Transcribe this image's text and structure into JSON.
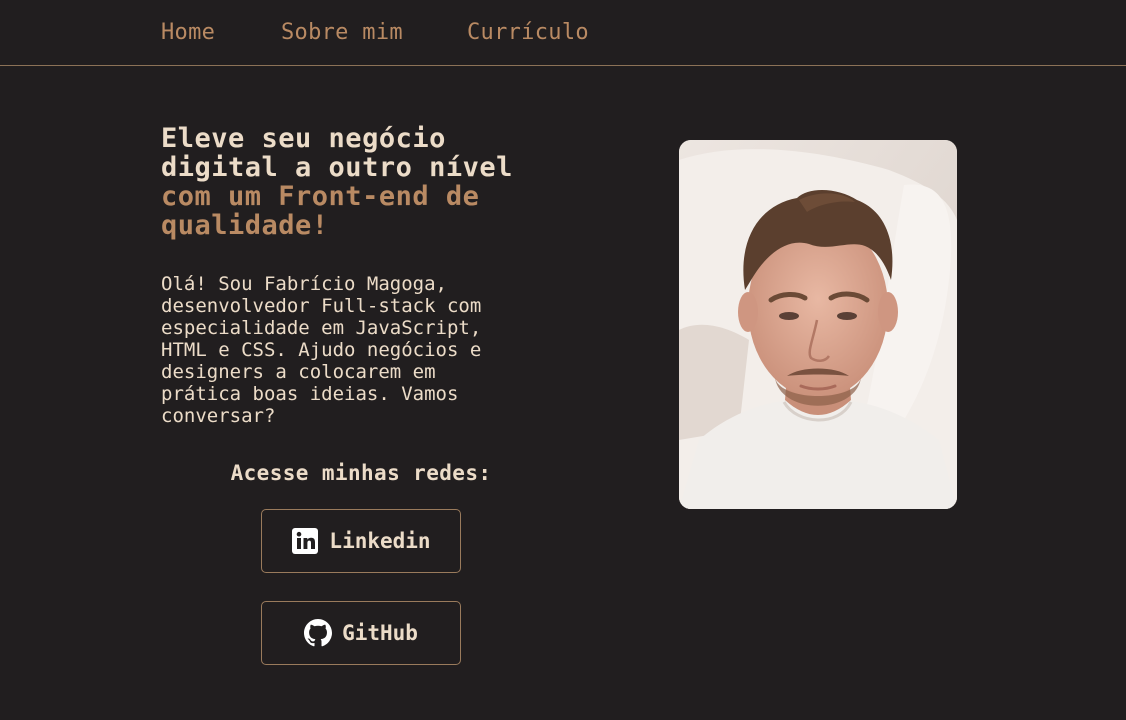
{
  "nav": {
    "items": [
      {
        "label": "Home"
      },
      {
        "label": "Sobre mim"
      },
      {
        "label": "Currículo"
      }
    ]
  },
  "hero": {
    "headline_line1": "Eleve seu negócio",
    "headline_line2": "digital a outro nível",
    "headline_accent1": "com um Front-end de",
    "headline_accent2": "qualidade!",
    "intro_lines": [
      "Olá! Sou Fabrício Magoga,",
      "desenvolvedor Full-stack com",
      "especialidade em JavaScript,",
      "HTML e CSS. Ajudo negócios e",
      "designers a colocarem em",
      "prática boas ideias. Vamos",
      "conversar?"
    ]
  },
  "social": {
    "heading": "Acesse minhas redes:",
    "linkedin_label": "Linkedin",
    "github_label": "GitHub"
  },
  "icons": {
    "linkedin": "linkedin-icon",
    "github": "github-icon"
  },
  "colors": {
    "background": "#211e1f",
    "text": "#ecdcc8",
    "accent": "#b98a63",
    "border": "#9a7b5c"
  }
}
